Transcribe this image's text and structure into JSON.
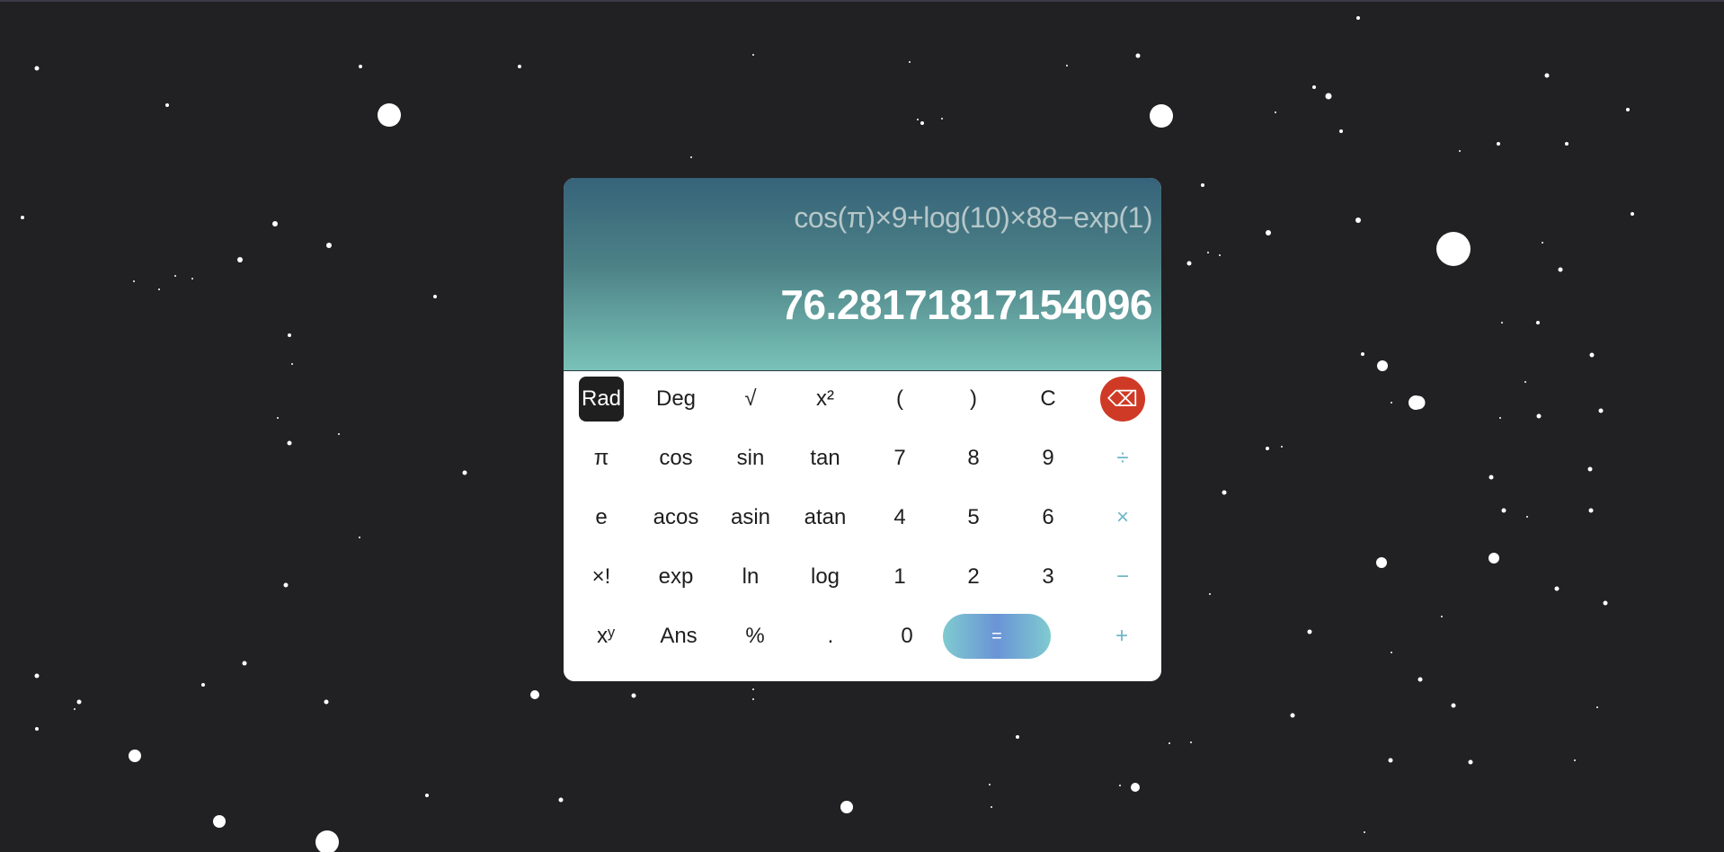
{
  "display": {
    "expression": "cos(π)×9+log(10)×88−exp(1)",
    "result": "76.28171817154096"
  },
  "keys": [
    [
      {
        "label": "Rad",
        "name": "rad-button",
        "kind": "active"
      },
      {
        "label": "Deg",
        "name": "deg-button"
      },
      {
        "label": "√",
        "name": "sqrt-button"
      },
      {
        "label": "x²",
        "name": "square-button"
      },
      {
        "label": "(",
        "name": "open-paren-button"
      },
      {
        "label": ")",
        "name": "close-paren-button"
      },
      {
        "label": "C",
        "name": "clear-button"
      },
      {
        "label": "⌫",
        "name": "backspace-button",
        "kind": "backspace"
      }
    ],
    [
      {
        "label": "π",
        "name": "pi-button"
      },
      {
        "label": "cos",
        "name": "cos-button"
      },
      {
        "label": "sin",
        "name": "sin-button"
      },
      {
        "label": "tan",
        "name": "tan-button"
      },
      {
        "label": "7",
        "name": "digit-7-button"
      },
      {
        "label": "8",
        "name": "digit-8-button"
      },
      {
        "label": "9",
        "name": "digit-9-button"
      },
      {
        "label": "÷",
        "name": "divide-button",
        "kind": "op"
      }
    ],
    [
      {
        "label": "e",
        "name": "e-button"
      },
      {
        "label": "acos",
        "name": "acos-button"
      },
      {
        "label": "asin",
        "name": "asin-button"
      },
      {
        "label": "atan",
        "name": "atan-button"
      },
      {
        "label": "4",
        "name": "digit-4-button"
      },
      {
        "label": "5",
        "name": "digit-5-button"
      },
      {
        "label": "6",
        "name": "digit-6-button"
      },
      {
        "label": "×",
        "name": "multiply-button",
        "kind": "op"
      }
    ],
    [
      {
        "label": "×!",
        "name": "factorial-button"
      },
      {
        "label": "exp",
        "name": "exp-button"
      },
      {
        "label": "ln",
        "name": "ln-button"
      },
      {
        "label": "log",
        "name": "log-button"
      },
      {
        "label": "1",
        "name": "digit-1-button"
      },
      {
        "label": "2",
        "name": "digit-2-button"
      },
      {
        "label": "3",
        "name": "digit-3-button"
      },
      {
        "label": "−",
        "name": "subtract-button",
        "kind": "op"
      }
    ],
    [
      {
        "label": "xʸ",
        "name": "power-button"
      },
      {
        "label": "Ans",
        "name": "ans-button"
      },
      {
        "label": "%",
        "name": "percent-button"
      },
      {
        "label": ".",
        "name": "decimal-button"
      },
      {
        "label": "0",
        "name": "digit-0-button"
      },
      {
        "label": "=",
        "name": "equals-button",
        "kind": "equals"
      },
      {
        "label": "+",
        "name": "add-button",
        "kind": "op"
      }
    ]
  ],
  "colors": {
    "background": "#212022",
    "star": "#ffffff",
    "backspace": "#cf3a26",
    "operator": "#6fb6c6",
    "active": "#1f1f1f"
  }
}
